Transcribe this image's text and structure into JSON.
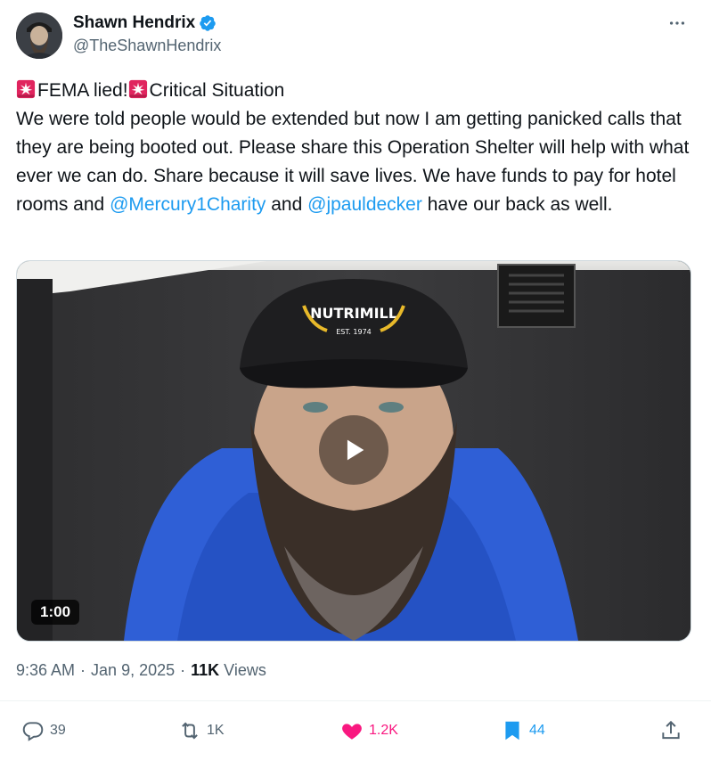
{
  "author": {
    "display_name": "Shawn Hendrix",
    "handle": "@TheShawnHendrix",
    "verified": true
  },
  "tweet": {
    "line1_a": "FEMA lied!",
    "line1_b": "Critical Situation",
    "body_part1": "We were told people would be extended but now I am getting panicked calls that they are being booted out. Please share this Operation Shelter will help with what ever we can do. Share because it will save lives.  We have funds to pay for hotel rooms and ",
    "mention1": "@Mercury1Charity",
    "body_part2": " and ",
    "mention2": "@jpauldecker",
    "body_part3": " have our back as well."
  },
  "media": {
    "type": "video",
    "duration": "1:00",
    "hat_text": "NUTRIMILL",
    "hat_subtext": "EST. 1974"
  },
  "meta": {
    "time": "9:36 AM",
    "separator1": "·",
    "date": "Jan 9, 2025",
    "separator2": "·",
    "views_count": "11K",
    "views_label": "Views"
  },
  "actions": {
    "replies": "39",
    "reposts": "1K",
    "likes": "1.2K",
    "bookmarks": "44"
  },
  "colors": {
    "accent": "#1d9bf0",
    "like": "#f91880",
    "muted": "#536471",
    "siren": "#e0245e"
  },
  "icons": {
    "more": "more-horizontal-icon",
    "verified": "verified-badge-icon",
    "siren": "rotating-light-emoji-icon",
    "play": "play-icon",
    "reply": "reply-icon",
    "repost": "repost-icon",
    "like": "heart-icon",
    "bookmark": "bookmark-icon",
    "share": "share-icon"
  }
}
